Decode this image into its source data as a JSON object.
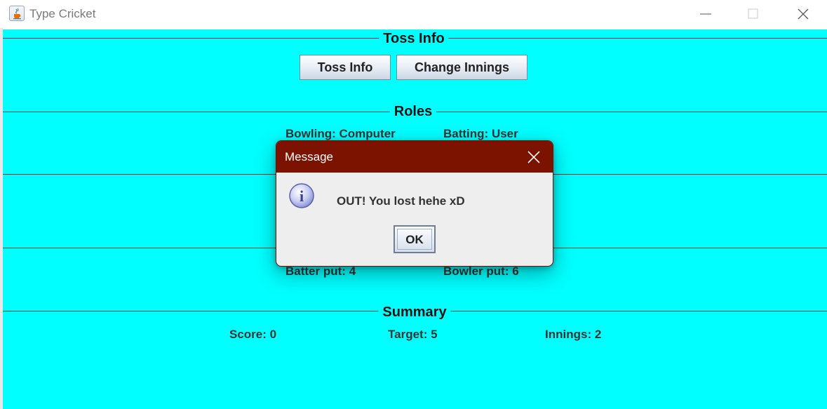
{
  "window": {
    "title": "Type Cricket",
    "icon": "java-cup-icon",
    "controls": [
      "minimize-icon",
      "maximize-icon",
      "close-icon"
    ]
  },
  "colors": {
    "background": "#00ffff",
    "dialog_titlebar": "#7c1200",
    "dialog_body": "#eeeeee"
  },
  "toss_section": {
    "title": "Toss Info",
    "buttons": {
      "toss_info": "Toss Info",
      "change_innings": "Change Innings"
    }
  },
  "roles_section": {
    "title": "Roles",
    "bowling_label": "Bowling:",
    "bowling_value": "Computer",
    "batting_label": "Batting:",
    "batting_value": "User"
  },
  "play_section": {
    "batter_put_label": "Batter put:",
    "batter_put_value": "4",
    "bowler_put_label": "Bowler put:",
    "bowler_put_value": "6"
  },
  "summary_section": {
    "title": "Summary",
    "score_label": "Score:",
    "score_value": "0",
    "target_label": "Target:",
    "target_value": "5",
    "innings_label": "Innings:",
    "innings_value": "2"
  },
  "dialog": {
    "title": "Message",
    "icon": "info-icon",
    "message": "OUT! You lost hehe xD",
    "ok_label": "OK"
  }
}
